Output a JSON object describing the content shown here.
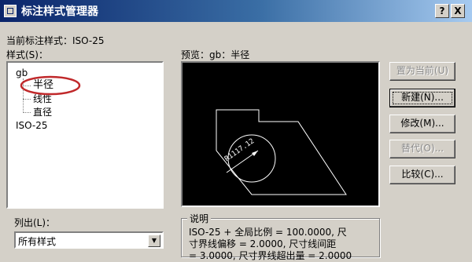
{
  "window": {
    "title": "标注样式管理器",
    "help_button": "?",
    "close_button": "X"
  },
  "current_style": {
    "label": "当前标注样式：ISO-25"
  },
  "styles_list": {
    "label": "样式(S)：",
    "items": [
      {
        "label": "gb"
      },
      {
        "label": "半径"
      },
      {
        "label": "线性"
      },
      {
        "label": "直径"
      },
      {
        "label": "ISO-25"
      }
    ]
  },
  "preview": {
    "label": "预览：gb：半径",
    "dimension_text": "R1117.12"
  },
  "buttons": {
    "set_current": "置为当前(U)",
    "new": "新建(N)...",
    "modify": "修改(M)...",
    "override": "替代(O)...",
    "compare": "比较(C)..."
  },
  "list_filter": {
    "label": "列出(L)：",
    "value": "所有样式"
  },
  "description": {
    "label": "说明",
    "line1": "ISO-25 + 全局比例 = 100.0000, 尺",
    "line2": "寸界线偏移 = 2.0000, 尺寸线间距",
    "line3": "= 3.0000, 尺寸界线超出量 = 2.0000"
  },
  "colors": {
    "dialog_bg": "#d4d0c8",
    "preview_bg": "#000000",
    "titlebar_start": "#0a246a",
    "highlight_circle": "#c0282a"
  }
}
